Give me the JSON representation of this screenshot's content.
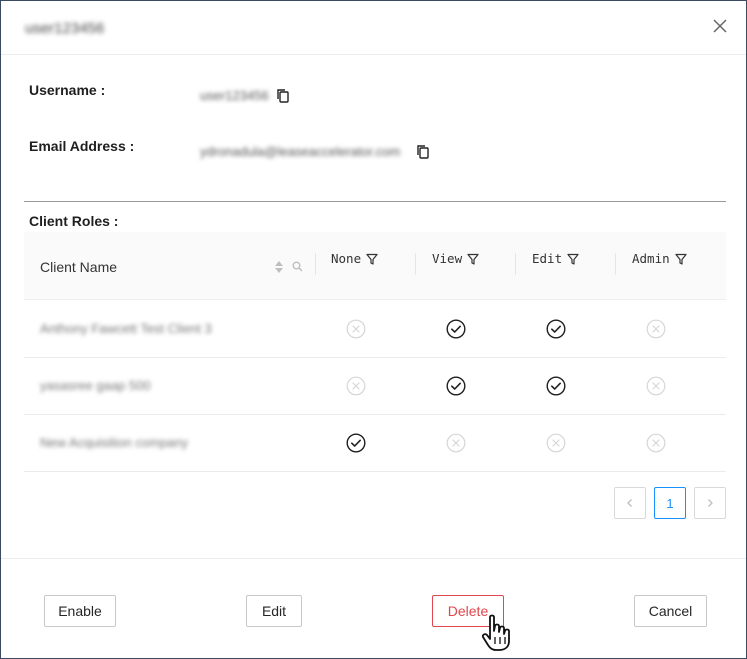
{
  "dialog": {
    "title": "user123456"
  },
  "fields": {
    "username_label": "Username :",
    "username_value": "user123456",
    "email_label": "Email Address :",
    "email_value": "ydronadula@leaseaccelerator.com"
  },
  "roles": {
    "label": "Client Roles :",
    "columns": {
      "client_name": "Client Name",
      "none": "None",
      "view": "View",
      "edit": "Edit",
      "admin": "Admin"
    },
    "rows": [
      {
        "client": "Anthony Fawcett Test Client 3",
        "none": false,
        "view": true,
        "edit": true,
        "admin": false
      },
      {
        "client": "yasasree gaap 500",
        "none": false,
        "view": true,
        "edit": true,
        "admin": false
      },
      {
        "client": "New Acquisition company",
        "none": true,
        "view": false,
        "edit": false,
        "admin": false
      }
    ]
  },
  "pagination": {
    "current_page": "1",
    "prev_icon": "chevron-left-icon",
    "next_icon": "chevron-right-icon"
  },
  "footer": {
    "enable_label": "Enable",
    "edit_label": "Edit",
    "delete_label": "Delete",
    "cancel_label": "Cancel"
  },
  "colors": {
    "danger": "#e0474f",
    "accent": "#1890ff",
    "check": "#1f1f1f",
    "inactive": "#d6d6d6"
  }
}
